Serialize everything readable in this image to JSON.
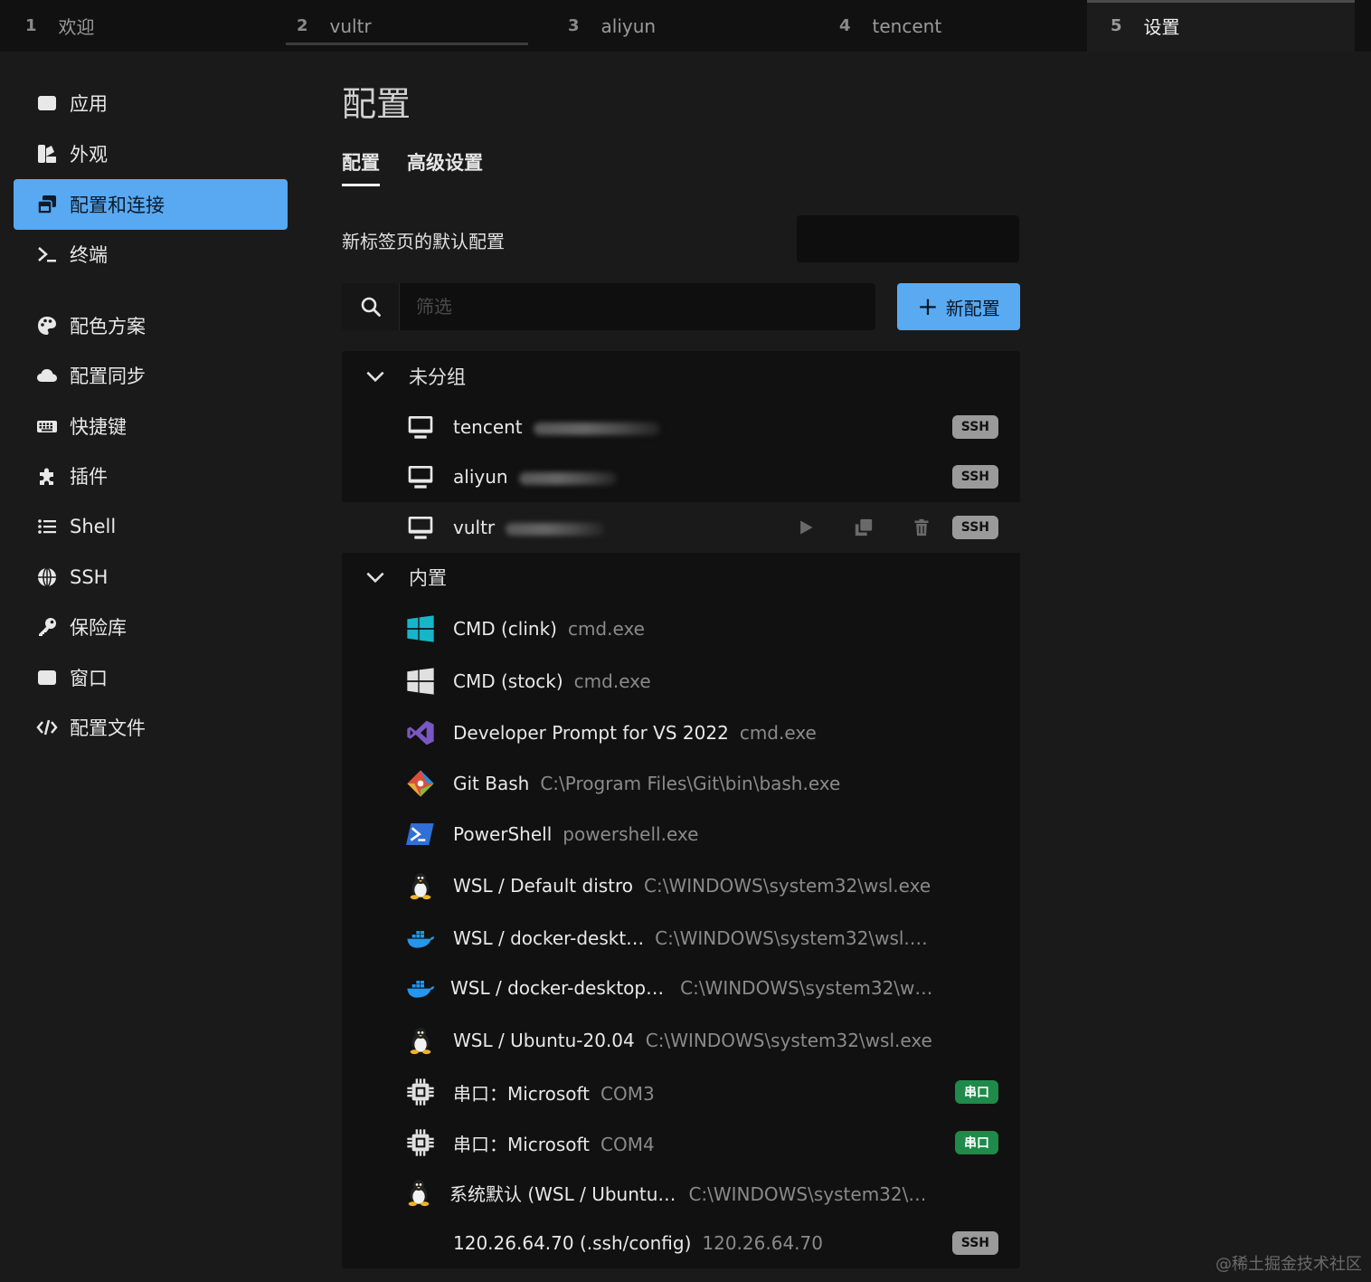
{
  "tabs": [
    {
      "num": "1",
      "label": "欢迎"
    },
    {
      "num": "2",
      "label": "vultr"
    },
    {
      "num": "3",
      "label": "aliyun"
    },
    {
      "num": "4",
      "label": "tencent"
    },
    {
      "num": "5",
      "label": "设置"
    }
  ],
  "sidebar": {
    "items": [
      {
        "label": "应用",
        "icon": "window-icon"
      },
      {
        "label": "外观",
        "icon": "palette-swatch-icon"
      },
      {
        "label": "配置和连接",
        "icon": "windows-stack-icon",
        "active": true
      },
      {
        "label": "终端",
        "icon": "terminal-prompt-icon"
      },
      {
        "label": "配色方案",
        "icon": "palette-icon"
      },
      {
        "label": "配置同步",
        "icon": "cloud-icon"
      },
      {
        "label": "快捷键",
        "icon": "keyboard-icon"
      },
      {
        "label": "插件",
        "icon": "puzzle-icon"
      },
      {
        "label": "Shell",
        "icon": "list-icon"
      },
      {
        "label": "SSH",
        "icon": "globe-icon"
      },
      {
        "label": "保险库",
        "icon": "key-icon"
      },
      {
        "label": "窗口",
        "icon": "window-icon"
      },
      {
        "label": "配置文件",
        "icon": "code-icon"
      }
    ]
  },
  "main": {
    "title": "配置",
    "subtabs": [
      {
        "label": "配置",
        "active": true
      },
      {
        "label": "高级设置"
      }
    ],
    "default_profile_label": "新标签页的默认配置",
    "default_profile_value": "",
    "filter_placeholder": "筛选",
    "new_profile_button": "新配置"
  },
  "groups": [
    {
      "name": "未分组",
      "profiles": [
        {
          "name": "tencent",
          "badge": "SSH",
          "icon": "monitor-icon"
        },
        {
          "name": "aliyun",
          "badge": "SSH",
          "icon": "monitor-icon"
        },
        {
          "name": "vultr",
          "badge": "SSH",
          "icon": "monitor-icon",
          "hovered": true
        }
      ]
    },
    {
      "name": "内置",
      "profiles": [
        {
          "name": "CMD (clink)",
          "cmd": "cmd.exe",
          "icon": "windows-logo-color-icon"
        },
        {
          "name": "CMD (stock)",
          "cmd": "cmd.exe",
          "icon": "windows-logo-gray-icon"
        },
        {
          "name": "Developer Prompt for VS 2022",
          "cmd": "cmd.exe",
          "icon": "visual-studio-icon"
        },
        {
          "name": "Git Bash",
          "cmd": "C:\\Program Files\\Git\\bin\\bash.exe",
          "icon": "git-icon"
        },
        {
          "name": "PowerShell",
          "cmd": "powershell.exe",
          "icon": "powershell-icon"
        },
        {
          "name": "WSL / Default distro",
          "cmd": "C:\\WINDOWS\\system32\\wsl.exe",
          "icon": "linux-penguin-icon"
        },
        {
          "name": "WSL / docker-deskt…",
          "cmd": "C:\\WINDOWS\\system32\\wsl.…",
          "icon": "docker-whale-icon"
        },
        {
          "name": "WSL / docker-desktop…",
          "cmd": "C:\\WINDOWS\\system32\\w…",
          "icon": "docker-whale-icon"
        },
        {
          "name": "WSL / Ubuntu-20.04",
          "cmd": "C:\\WINDOWS\\system32\\wsl.exe",
          "icon": "linux-penguin-icon"
        },
        {
          "name": "串口：Microsoft",
          "cmd": "COM3",
          "badge": "串口",
          "icon": "chip-icon"
        },
        {
          "name": "串口：Microsoft",
          "cmd": "COM4",
          "badge": "串口",
          "icon": "chip-icon"
        },
        {
          "name": "系统默认 (WSL / Ubuntu…",
          "cmd": "C:\\WINDOWS\\system32\\…",
          "icon": "linux-penguin-icon"
        },
        {
          "name": "120.26.64.70 (.ssh/config)",
          "cmd": "120.26.64.70",
          "badge": "SSH"
        }
      ]
    }
  ],
  "watermark": "@稀土掘金技术社区",
  "colors": {
    "accent": "#58a9f2",
    "background": "#1a1a1a",
    "panel": "#111111",
    "ssh_badge": "#9a9a9a",
    "serial_badge": "#1f8a4a"
  }
}
